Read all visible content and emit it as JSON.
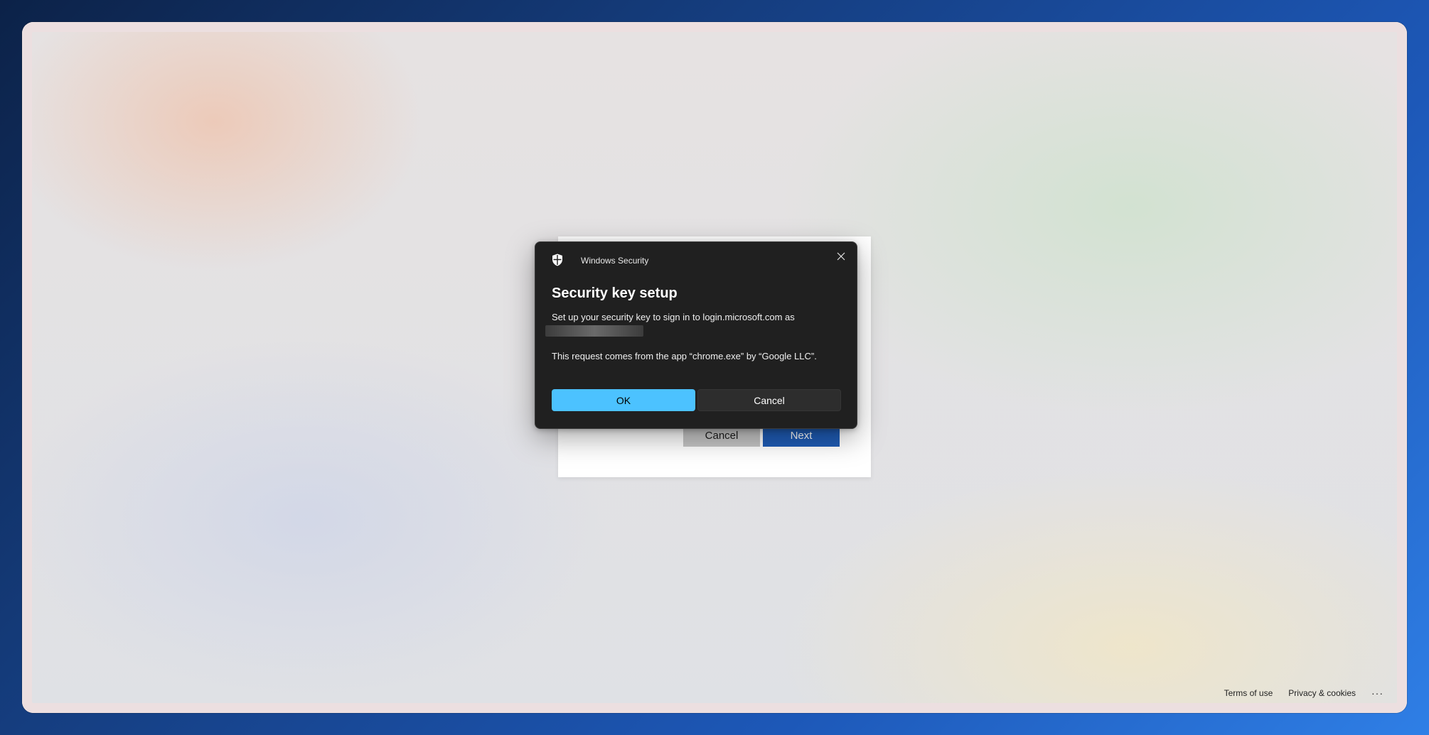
{
  "dialog": {
    "app_name": "Windows Security",
    "heading": "Security key setup",
    "message": "Set up your security key to sign in to login.microsoft.com as",
    "request": "This request comes from the app “chrome.exe” by “Google LLC”.",
    "ok_label": "OK",
    "cancel_label": "Cancel",
    "accent_color": "#4cc2ff",
    "icons": {
      "app": "shield-icon",
      "close": "close-icon"
    }
  },
  "signin_card": {
    "cancel_label": "Cancel",
    "next_label": "Next",
    "next_color": "#1f5cb5"
  },
  "footer": {
    "terms_label": "Terms of use",
    "privacy_label": "Privacy & cookies",
    "more_label": "···"
  }
}
